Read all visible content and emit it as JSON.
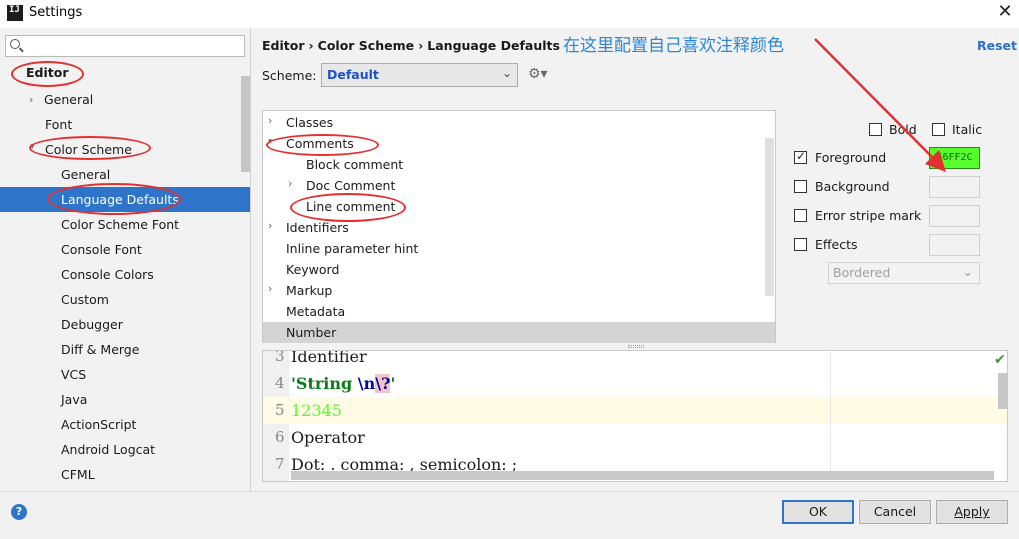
{
  "window": {
    "title": "Settings",
    "logo": "IJ"
  },
  "sidebar": {
    "search_placeholder": "",
    "items": [
      {
        "label": "Editor"
      },
      {
        "label": "General"
      },
      {
        "label": "Font"
      },
      {
        "label": "Color Scheme"
      },
      {
        "label": "General"
      },
      {
        "label": "Language Defaults"
      },
      {
        "label": "Color Scheme Font"
      },
      {
        "label": "Console Font"
      },
      {
        "label": "Console Colors"
      },
      {
        "label": "Custom"
      },
      {
        "label": "Debugger"
      },
      {
        "label": "Diff & Merge"
      },
      {
        "label": "VCS"
      },
      {
        "label": "Java"
      },
      {
        "label": "ActionScript"
      },
      {
        "label": "Android Logcat"
      },
      {
        "label": "CFML"
      }
    ]
  },
  "header": {
    "breadcrumb": [
      "Editor",
      "›",
      "Color Scheme",
      "›",
      "Language Defaults"
    ],
    "reset_label": "Reset",
    "annotation": "在这里配置自己喜欢注释颜色"
  },
  "scheme": {
    "label": "Scheme:",
    "value": "Default"
  },
  "attributes": {
    "items": [
      {
        "label": "Classes"
      },
      {
        "label": "Comments"
      },
      {
        "label": "Block comment"
      },
      {
        "label": "Doc Comment"
      },
      {
        "label": "Line comment"
      },
      {
        "label": "Identifiers"
      },
      {
        "label": "Inline parameter hint"
      },
      {
        "label": "Keyword"
      },
      {
        "label": "Markup"
      },
      {
        "label": "Metadata"
      },
      {
        "label": "Number"
      }
    ]
  },
  "options": {
    "bold_label": "Bold",
    "italic_label": "Italic",
    "foreground_label": "Foreground",
    "foreground_value": "56FF2C",
    "foreground_color": "#56ff2c",
    "background_label": "Background",
    "error_stripe_label": "Error stripe mark",
    "effects_label": "Effects",
    "effects_value": "Bordered"
  },
  "preview": {
    "lines": [
      {
        "num": "3",
        "text": "Identifier"
      },
      {
        "num": "4",
        "text": "'String \\n\\?'"
      },
      {
        "num": "5",
        "text": "12345"
      },
      {
        "num": "6",
        "text": "Operator"
      },
      {
        "num": "7",
        "text": "Dot: . comma: , semicolon: ;"
      }
    ],
    "string_part": "'String ",
    "escape_part": "\\n",
    "invalid_escape": "\\?",
    "string_end": "'",
    "number_color": "#56ff2c"
  },
  "footer": {
    "help": "?",
    "ok_label": "OK",
    "cancel_label": "Cancel",
    "apply_label": "Apply"
  }
}
